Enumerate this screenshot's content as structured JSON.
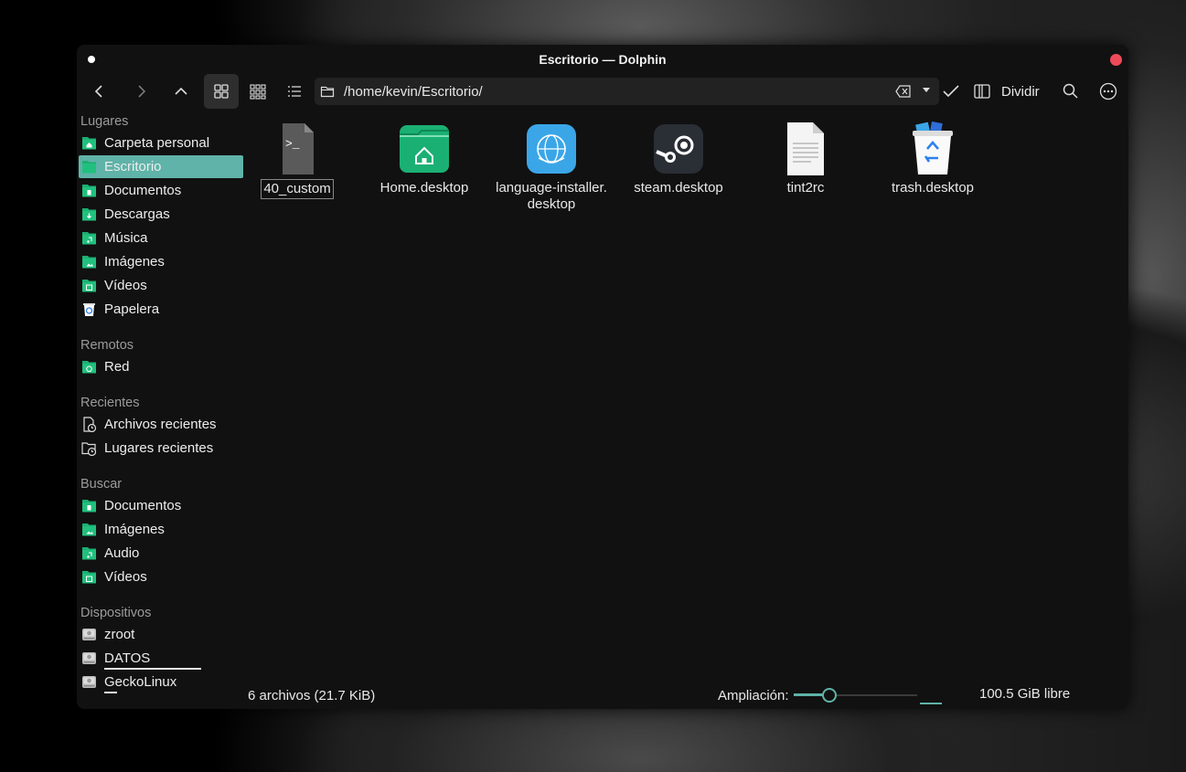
{
  "window": {
    "title": "Escritorio — Dolphin"
  },
  "toolbar": {
    "path": "/home/kevin/Escritorio/",
    "split_label": "Dividir"
  },
  "sidebar": {
    "sections": [
      {
        "title": "Lugares",
        "items": [
          {
            "label": "Carpeta personal",
            "icon": "home-folder-icon",
            "selected": false
          },
          {
            "label": "Escritorio",
            "icon": "desktop-folder-icon",
            "selected": true
          },
          {
            "label": "Documentos",
            "icon": "documents-folder-icon",
            "selected": false
          },
          {
            "label": "Descargas",
            "icon": "downloads-folder-icon",
            "selected": false
          },
          {
            "label": "Música",
            "icon": "music-folder-icon",
            "selected": false
          },
          {
            "label": "Imágenes",
            "icon": "pictures-folder-icon",
            "selected": false
          },
          {
            "label": "Vídeos",
            "icon": "videos-folder-icon",
            "selected": false
          },
          {
            "label": "Papelera",
            "icon": "trash-icon",
            "selected": false
          }
        ]
      },
      {
        "title": "Remotos",
        "items": [
          {
            "label": "Red",
            "icon": "network-folder-icon",
            "selected": false
          }
        ]
      },
      {
        "title": "Recientes",
        "items": [
          {
            "label": "Archivos recientes",
            "icon": "recent-files-icon",
            "selected": false
          },
          {
            "label": "Lugares recientes",
            "icon": "recent-places-icon",
            "selected": false
          }
        ]
      },
      {
        "title": "Buscar",
        "items": [
          {
            "label": "Documentos",
            "icon": "documents-folder-icon",
            "selected": false
          },
          {
            "label": "Imágenes",
            "icon": "pictures-folder-icon",
            "selected": false
          },
          {
            "label": "Audio",
            "icon": "music-folder-icon",
            "selected": false
          },
          {
            "label": "Vídeos",
            "icon": "videos-folder-icon",
            "selected": false
          }
        ]
      },
      {
        "title": "Dispositivos",
        "items": [
          {
            "label": "zroot",
            "icon": "drive-icon",
            "selected": false
          },
          {
            "label": "DATOS",
            "icon": "drive-icon",
            "selected": false
          },
          {
            "label": "GeckoLinux",
            "icon": "drive-icon",
            "selected": false
          }
        ]
      }
    ]
  },
  "files": [
    {
      "name": "40_custom",
      "icon": "script-file-icon"
    },
    {
      "name": "Home.desktop",
      "icon": "home-folder-large-icon"
    },
    {
      "name": "language-installer.\ndesktop",
      "icon": "language-globe-icon"
    },
    {
      "name": "steam.desktop",
      "icon": "steam-icon"
    },
    {
      "name": "tint2rc",
      "icon": "text-file-icon"
    },
    {
      "name": "trash.desktop",
      "icon": "trash-full-icon"
    }
  ],
  "statusbar": {
    "count": "6 archivos (21.7 KiB)",
    "zoom_label": "Ampliación:",
    "free_space": "100.5 GiB libre"
  },
  "colors": {
    "accent": "#5fb3a8",
    "folder_green": "#1bb073",
    "close": "#ee4b5a"
  }
}
